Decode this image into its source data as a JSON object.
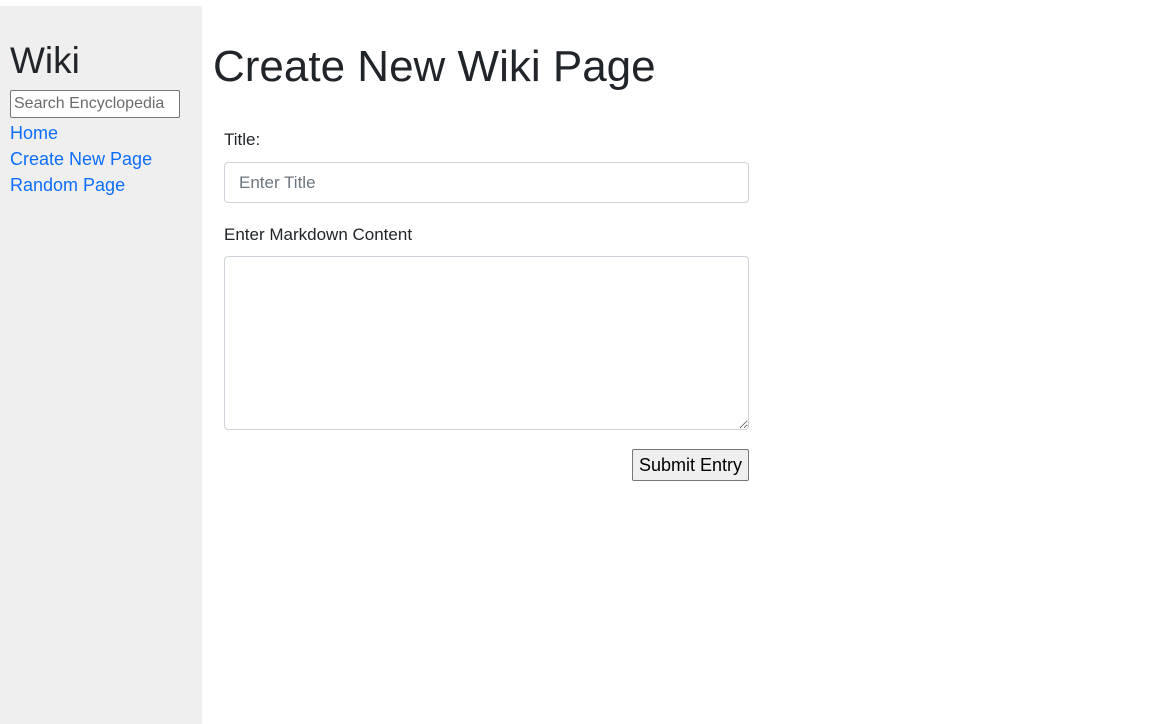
{
  "sidebar": {
    "title": "Wiki",
    "search": {
      "placeholder": "Search Encyclopedia",
      "value": ""
    },
    "links": {
      "home": "Home",
      "create_new_page": "Create New Page",
      "random_page": "Random Page"
    },
    "link_color": "#0d6efd",
    "background_color": "#efefef"
  },
  "main": {
    "page_title": "Create New Wiki Page",
    "form": {
      "title_label": "Title:",
      "title_placeholder": "Enter Title",
      "title_value": "",
      "content_label": "Enter Markdown Content",
      "content_value": "",
      "submit_label": "Submit Entry"
    }
  }
}
